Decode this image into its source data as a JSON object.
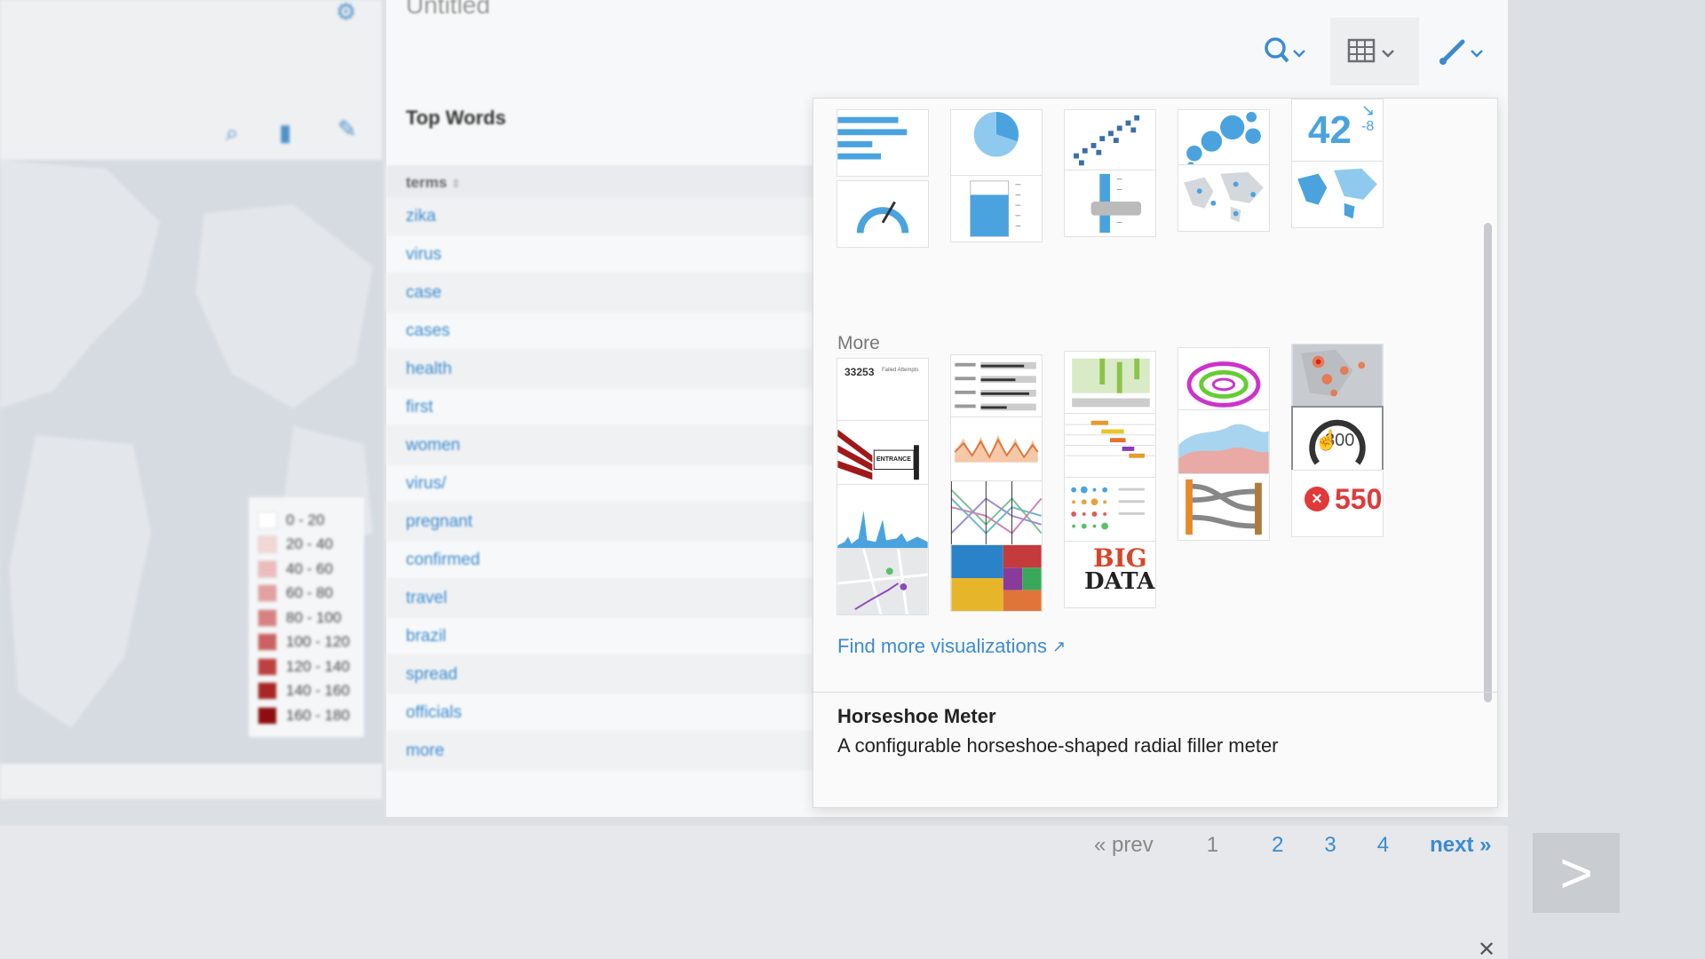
{
  "left_panel": {
    "legend": [
      {
        "label": "0 - 20",
        "color": "#ffffff"
      },
      {
        "label": "20 - 40",
        "color": "#f3d6d6"
      },
      {
        "label": "40 - 60",
        "color": "#ecbcbc"
      },
      {
        "label": "60 - 80",
        "color": "#e3a0a0"
      },
      {
        "label": "80 - 100",
        "color": "#d78181"
      },
      {
        "label": "100 - 120",
        "color": "#cb6161"
      },
      {
        "label": "120 - 140",
        "color": "#bd4141"
      },
      {
        "label": "140 - 160",
        "color": "#a82626"
      },
      {
        "label": "160 - 180",
        "color": "#8e0e0e"
      }
    ]
  },
  "main": {
    "title": "Untitled",
    "table_title": "Top Words",
    "column_header": "terms",
    "rows": [
      "zika",
      "virus",
      "case",
      "cases",
      "health",
      "first",
      "women",
      "virus/",
      "pregnant",
      "confirmed",
      "travel",
      "brazil",
      "spread",
      "officials",
      "more"
    ]
  },
  "picker": {
    "more_label": "More",
    "tile_texts": {
      "single_value_number": "42",
      "single_value_delta": "-8",
      "status_value": "550",
      "status_small": "33253",
      "status_caption": "Failed Attempts",
      "meter_value": "300",
      "wordcloud_big": "BIG",
      "wordcloud_data": "DATA",
      "entrance": "ENTRANCE"
    },
    "find_more": "Find more visualizations",
    "selected_title": "Horseshoe Meter",
    "selected_description": "A configurable horseshoe-shaped radial filler meter"
  },
  "pagination": {
    "prev": "« prev",
    "pages": [
      "1",
      "2",
      "3",
      "4"
    ],
    "current": "1",
    "next": "next »"
  },
  "colors": {
    "accent": "#3b8bd0",
    "viz_blue": "#4aa3df"
  }
}
